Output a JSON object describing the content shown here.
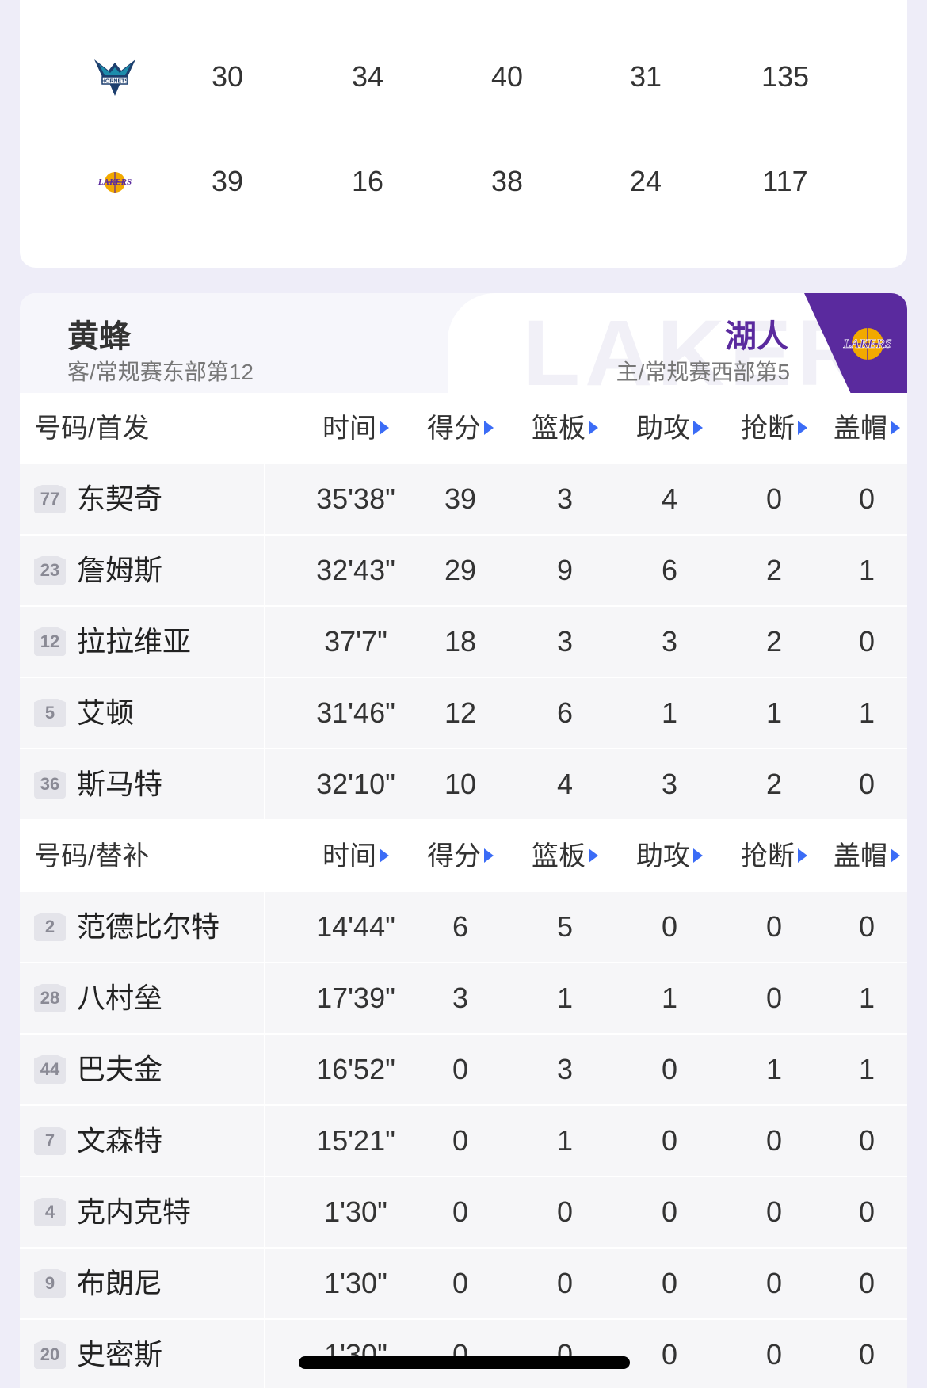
{
  "scoreboard": {
    "rows": [
      {
        "team_icon": "hornets-logo-icon",
        "quarters": [
          "30",
          "34",
          "40",
          "31"
        ],
        "total": "135"
      },
      {
        "team_icon": "lakers-logo-icon",
        "quarters": [
          "39",
          "16",
          "38",
          "24"
        ],
        "total": "117"
      }
    ]
  },
  "team_header": {
    "away_name": "黄蜂",
    "away_sub": "客/常规赛东部第12",
    "home_name": "湖人",
    "home_sub": "主/常规赛西部第5",
    "watermark": "LAKERS",
    "home_color": "#5a2a9e"
  },
  "columns": [
    "时间",
    "得分",
    "篮板",
    "助攻",
    "抢断",
    "盖帽"
  ],
  "starters": {
    "label": "号码/首发",
    "players": [
      {
        "num": "77",
        "name": "东契奇",
        "stats": [
          "35'38\"",
          "39",
          "3",
          "4",
          "0",
          "0"
        ]
      },
      {
        "num": "23",
        "name": "詹姆斯",
        "stats": [
          "32'43\"",
          "29",
          "9",
          "6",
          "2",
          "1"
        ]
      },
      {
        "num": "12",
        "name": "拉拉维亚",
        "stats": [
          "37'7\"",
          "18",
          "3",
          "3",
          "2",
          "0"
        ]
      },
      {
        "num": "5",
        "name": "艾顿",
        "stats": [
          "31'46\"",
          "12",
          "6",
          "1",
          "1",
          "1"
        ]
      },
      {
        "num": "36",
        "name": "斯马特",
        "stats": [
          "32'10\"",
          "10",
          "4",
          "3",
          "2",
          "0"
        ]
      }
    ]
  },
  "bench": {
    "label": "号码/替补",
    "players": [
      {
        "num": "2",
        "name": "范德比尔特",
        "stats": [
          "14'44\"",
          "6",
          "5",
          "0",
          "0",
          "0"
        ]
      },
      {
        "num": "28",
        "name": "八村垒",
        "stats": [
          "17'39\"",
          "3",
          "1",
          "1",
          "0",
          "1"
        ]
      },
      {
        "num": "44",
        "name": "巴夫金",
        "stats": [
          "16'52\"",
          "0",
          "3",
          "0",
          "1",
          "1"
        ]
      },
      {
        "num": "7",
        "name": "文森特",
        "stats": [
          "15'21\"",
          "0",
          "1",
          "0",
          "0",
          "0"
        ]
      },
      {
        "num": "4",
        "name": "克内克特",
        "stats": [
          "1'30\"",
          "0",
          "0",
          "0",
          "0",
          "0"
        ]
      },
      {
        "num": "9",
        "name": "布朗尼",
        "stats": [
          "1'30\"",
          "0",
          "0",
          "0",
          "0",
          "0"
        ]
      },
      {
        "num": "20",
        "name": "史密斯",
        "stats": [
          "1'30\"",
          "0",
          "0",
          "0",
          "0",
          "0"
        ]
      }
    ]
  },
  "colors": {
    "accent": "#3b6cf6",
    "lakers_purple": "#5a2a9e",
    "lakers_gold": "#f2a900",
    "hornets_teal": "#1d8cab"
  }
}
